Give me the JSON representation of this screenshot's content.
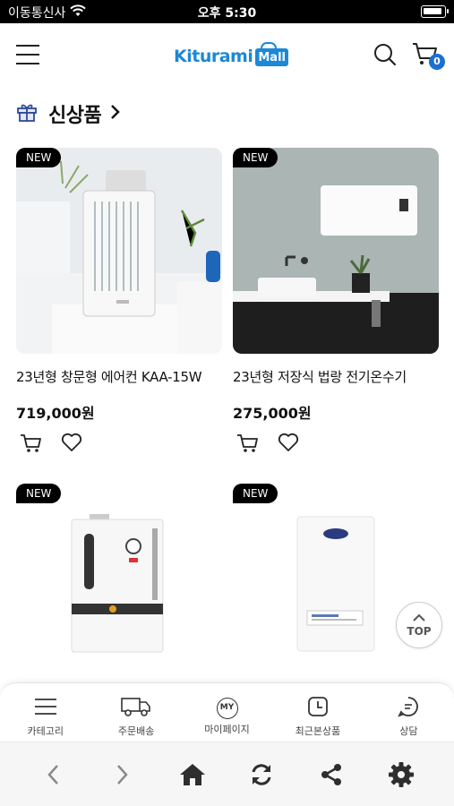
{
  "status_bar": {
    "carrier": "이동통신사",
    "time": "오후 5:30"
  },
  "header": {
    "logo_text": "Kiturami",
    "logo_box": "Mall",
    "cart_count": "0"
  },
  "section": {
    "title": "신상품"
  },
  "products": [
    {
      "badge": "NEW",
      "name": "23년형 창문형 에어컨 KAA-15W",
      "price": "719,000원"
    },
    {
      "badge": "NEW",
      "name": "23년형 저장식 법랑 전기온수기",
      "price": "275,000원"
    },
    {
      "badge": "NEW",
      "name": "",
      "price": ""
    },
    {
      "badge": "NEW",
      "name": "",
      "price": ""
    }
  ],
  "top_button": {
    "label": "TOP"
  },
  "tab_bar": {
    "items": [
      {
        "label": "카테고리",
        "icon": "menu-icon"
      },
      {
        "label": "주문배송",
        "icon": "truck-icon"
      },
      {
        "label": "마이페이지",
        "icon": "my-icon",
        "icon_text": "MY"
      },
      {
        "label": "최근본상품",
        "icon": "clock-icon"
      },
      {
        "label": "상담",
        "icon": "chat-icon"
      }
    ]
  },
  "browser_bar": {
    "icons": [
      "back-icon",
      "forward-icon",
      "home-icon",
      "refresh-icon",
      "share-icon",
      "settings-icon"
    ]
  },
  "colors": {
    "brand": "#1c88d6",
    "badge": "#1c6fd0",
    "status_bar": "#000000"
  }
}
